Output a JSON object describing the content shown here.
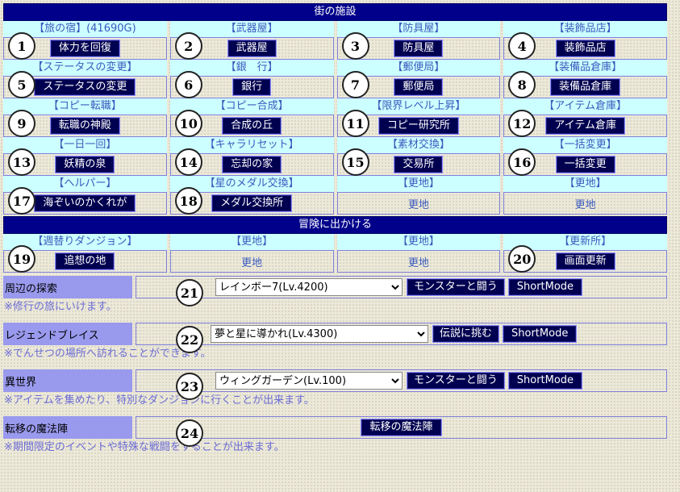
{
  "town": {
    "header": "街の施設",
    "cells": [
      {
        "n": "1",
        "title": "【旅の宿】(41690G)",
        "button": "体力を回復"
      },
      {
        "n": "2",
        "title": "【武器屋】",
        "button": "武器屋"
      },
      {
        "n": "3",
        "title": "【防具屋】",
        "button": "防具屋"
      },
      {
        "n": "4",
        "title": "【装飾品店】",
        "button": "装飾品店"
      },
      {
        "n": "5",
        "title": "【ステータスの変更】",
        "button": "ステータスの変更"
      },
      {
        "n": "6",
        "title": "【銀　行】",
        "button": "銀行"
      },
      {
        "n": "7",
        "title": "【郵便局】",
        "button": "郵便局"
      },
      {
        "n": "8",
        "title": "【装備品倉庫】",
        "button": "装備品倉庫"
      },
      {
        "n": "9",
        "title": "【コピー転職】",
        "button": "転職の神殿"
      },
      {
        "n": "10",
        "title": "【コピー合成】",
        "button": "合成の丘"
      },
      {
        "n": "11",
        "title": "【限界レベル上昇】",
        "button": "コピー研究所"
      },
      {
        "n": "12",
        "title": "【アイテム倉庫】",
        "button": "アイテム倉庫"
      },
      {
        "n": "13",
        "title": "【一日一回】",
        "button": "妖精の泉"
      },
      {
        "n": "14",
        "title": "【キャラリセット】",
        "button": "忘却の家"
      },
      {
        "n": "15",
        "title": "【素材交換】",
        "button": "交易所"
      },
      {
        "n": "16",
        "title": "【一括変更】",
        "button": "一括変更"
      },
      {
        "n": "17",
        "title": "【ヘルパー】",
        "button": "海ぞいのかくれが"
      },
      {
        "n": "18",
        "title": "【星のメダル交換】",
        "button": "メダル交換所"
      },
      {
        "n": "",
        "title": "【更地】",
        "text": "更地"
      },
      {
        "n": "",
        "title": "【更地】",
        "text": "更地"
      }
    ]
  },
  "adventure": {
    "header": "冒険に出かける",
    "cells": [
      {
        "n": "19",
        "title": "【週替りダンジョン】",
        "button": "追想の地"
      },
      {
        "n": "",
        "title": "【更地】",
        "text": "更地"
      },
      {
        "n": "",
        "title": "【更地】",
        "text": "更地"
      },
      {
        "n": "20",
        "title": "【更新所】",
        "button": "画面更新"
      }
    ],
    "rows": [
      {
        "n": "21",
        "label": "周辺の探索",
        "select": "レインボー7(Lv.4200)",
        "action": "モンスターと闘う",
        "short": "ShortMode",
        "note": "※修行の旅にいけます。"
      },
      {
        "n": "22",
        "label": "レジェンドブレイス",
        "select": "夢と星に導かれ(Lv.4300)",
        "action": "伝説に挑む",
        "short": "ShortMode",
        "note": "※でんせつの場所へ訪れることができます。"
      },
      {
        "n": "23",
        "label": "異世界",
        "select": "ウィングガーデン(Lv.100)",
        "action": "モンスターと闘う",
        "short": "ShortMode",
        "note": "※アイテムを集めたり、特別なダンジョンに行くことが出来ます。"
      },
      {
        "n": "24",
        "label": "転移の魔法陣",
        "action": "転移の魔法陣",
        "note": "※期間限定のイベントや特殊な戦闘をすることが出来ます。"
      }
    ]
  }
}
